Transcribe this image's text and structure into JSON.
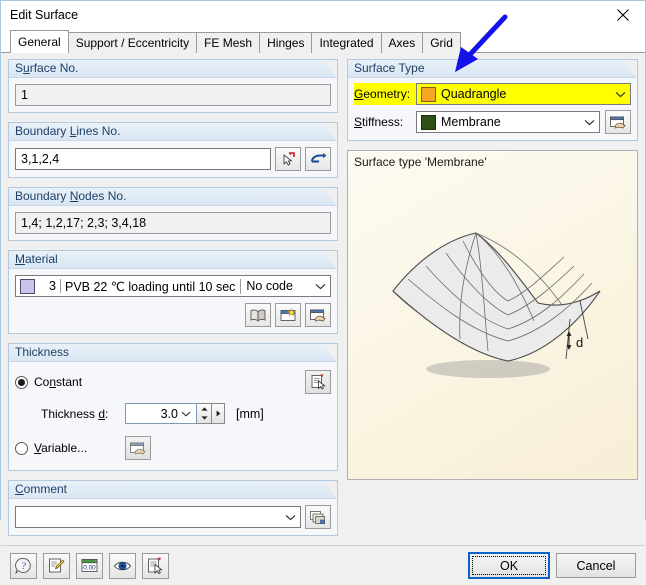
{
  "window": {
    "title": "Edit Surface",
    "close_icon": "close-icon"
  },
  "tabs": [
    {
      "label": "General",
      "active": true
    },
    {
      "label": "Support / Eccentricity",
      "active": false
    },
    {
      "label": "FE Mesh",
      "active": false
    },
    {
      "label": "Hinges",
      "active": false
    },
    {
      "label": "Integrated",
      "active": false
    },
    {
      "label": "Axes",
      "active": false
    },
    {
      "label": "Grid",
      "active": false
    }
  ],
  "left": {
    "surface_no": {
      "legend_pre": "S",
      "legend_accel": "u",
      "legend_post": "rface No.",
      "value": "1"
    },
    "boundary_lines": {
      "legend_pre": "Boundary ",
      "legend_accel": "L",
      "legend_post": "ines No.",
      "value": "3,1,2,4",
      "pick_button": "pick-lines-icon",
      "reverse_button": "reverse-direction-icon"
    },
    "boundary_nodes": {
      "legend_pre": "Boundary ",
      "legend_accel": "N",
      "legend_post": "odes No.",
      "value": "1,4; 1,2,17; 2,3; 3,4,18"
    },
    "material": {
      "legend_pre": "",
      "legend_accel": "M",
      "legend_post": "aterial",
      "swatch_color": "#c9c4ea",
      "number": "3",
      "name": "PVB 22 ℃ loading until 10 sec",
      "code": "No code",
      "library_button": "material-library-icon",
      "new_button": "new-material-icon",
      "edit_button": "edit-material-icon"
    },
    "thickness": {
      "legend": "Thickness",
      "constant_pre": "Co",
      "constant_accel": "n",
      "constant_post": "stant",
      "constant_selected": true,
      "thickness_label_pre": "Thickness ",
      "thickness_label_accel": "d",
      "thickness_label_post": ":",
      "thickness_value": "3.0",
      "thickness_unit": "[mm]",
      "variable_pre": "",
      "variable_accel": "V",
      "variable_post": "ariable...",
      "variable_selected": false,
      "variable_button": "edit-variable-thickness-icon",
      "info_button": "thickness-info-icon"
    },
    "comment": {
      "legend_pre": "",
      "legend_accel": "C",
      "legend_post": "omment",
      "value": "",
      "pick_button": "comment-list-icon"
    }
  },
  "right": {
    "surface_type": {
      "legend": "Surface Type",
      "geometry": {
        "label_pre": "",
        "label_accel": "G",
        "label_post": "eometry:",
        "value": "Quadrangle",
        "swatch_color": "#f5a623",
        "highlighted": true,
        "highlight_color": "#ffff00"
      },
      "stiffness": {
        "label_pre": "",
        "label_accel": "S",
        "label_post": "tiffness:",
        "value": "Membrane",
        "swatch_color": "#2d5016",
        "edit_button": "edit-stiffness-icon"
      }
    },
    "preview": {
      "caption": "Surface type 'Membrane'",
      "dimension_label": "d"
    }
  },
  "footer": {
    "tool_buttons": [
      {
        "name": "help-icon",
        "title": "Help"
      },
      {
        "name": "edit-note-icon",
        "title": "Edit"
      },
      {
        "name": "units-icon",
        "title": "Units"
      },
      {
        "name": "view-eye-icon",
        "title": "View"
      },
      {
        "name": "select-document-icon",
        "title": "Select"
      }
    ],
    "ok_label": "OK",
    "cancel_label": "Cancel"
  },
  "annotation": {
    "arrow_color": "#1414ea"
  }
}
